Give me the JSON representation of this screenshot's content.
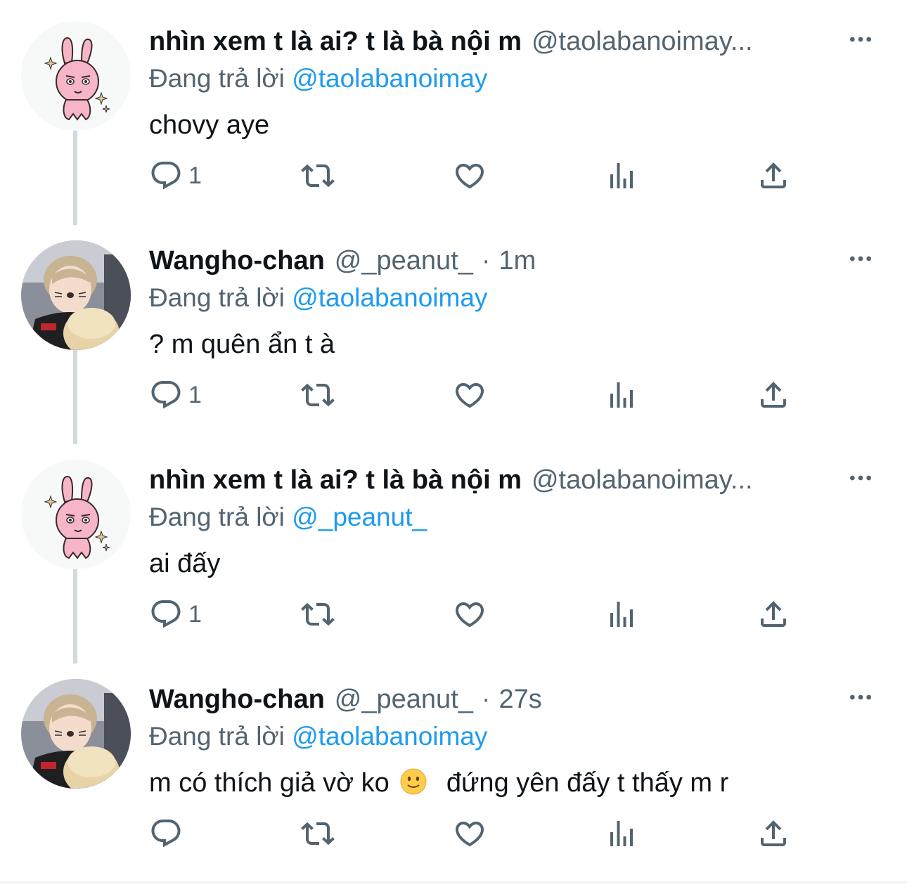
{
  "tweets": [
    {
      "display_name": "nhìn xem t là ai? t là bà nội m",
      "handle": "@taolabanoimay...",
      "time": "",
      "reply_prefix": "Đang trả lời",
      "reply_to": "@taolabanoimay",
      "text": "chovy aye",
      "reply_count": "1",
      "avatar": "bunny-avatar"
    },
    {
      "display_name": "Wangho-chan",
      "handle": "@_peanut_",
      "time": "1m",
      "reply_prefix": "Đang trả lời",
      "reply_to": "@taolabanoimay",
      "text": "? m quên ẩn t à",
      "reply_count": "1",
      "avatar": "person-avatar"
    },
    {
      "display_name": "nhìn xem t là ai? t là bà nội m",
      "handle": "@taolabanoimay...",
      "time": "",
      "reply_prefix": "Đang trả lời",
      "reply_to": "@_peanut_",
      "text": "ai đấy",
      "reply_count": "1",
      "avatar": "bunny-avatar"
    },
    {
      "display_name": "Wangho-chan",
      "handle": "@_peanut_",
      "time": "27s",
      "reply_prefix": "Đang trả lời",
      "reply_to": "@taolabanoimay",
      "text_before_emoji": "m có thích giả vờ ko",
      "text_after_emoji": "đứng yên đấy t thấy m r",
      "reply_count": "",
      "avatar": "person-avatar"
    }
  ],
  "dot_separator": "·",
  "colors": {
    "accent": "#1d9bf0",
    "secondary_text": "#536471",
    "thread_line": "#cfd9de"
  }
}
